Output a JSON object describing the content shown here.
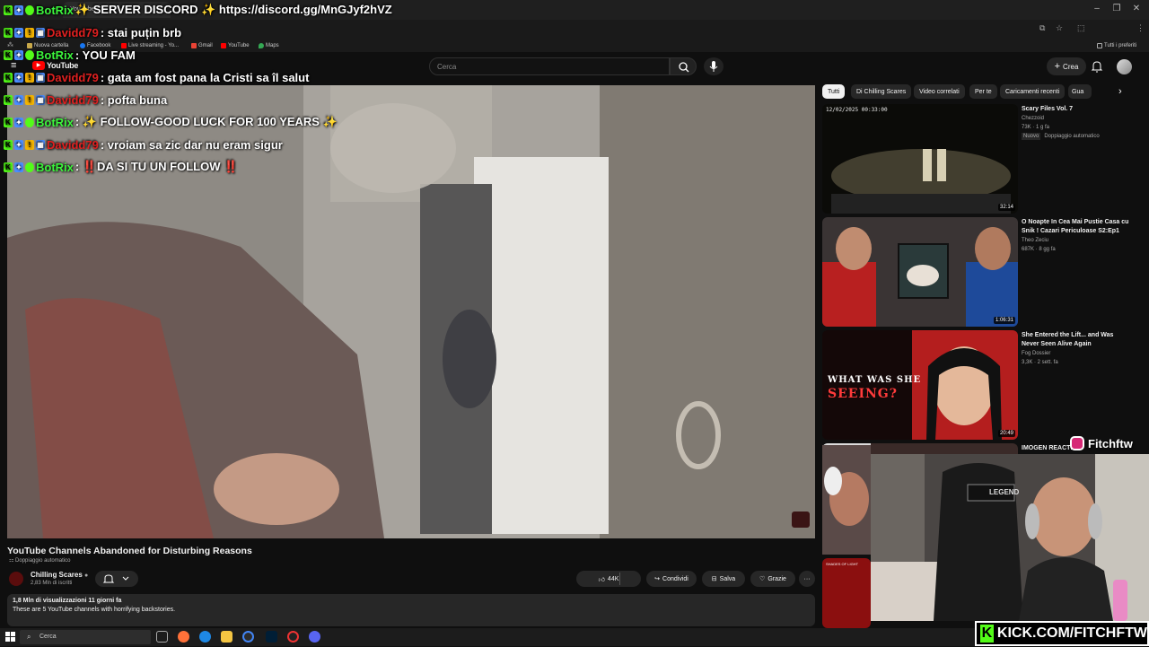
{
  "browser": {
    "tab_title": "YouTube",
    "bookmarks": [
      {
        "label": "Nuova cartella",
        "icon": "folder-icon"
      },
      {
        "label": "Facebook",
        "icon": "facebook-icon"
      },
      {
        "label": "Live streaming - Yo...",
        "icon": "youtube-icon"
      },
      {
        "label": "Gmail",
        "icon": "gmail-icon"
      },
      {
        "label": "YouTube",
        "icon": "youtube-icon"
      },
      {
        "label": "Maps",
        "icon": "maps-icon"
      }
    ],
    "all_bookmarks": "Tutti i preferiti"
  },
  "youtube": {
    "logo": "YouTube",
    "search_placeholder": "Cerca",
    "create_label": "Crea"
  },
  "video": {
    "title": "YouTube Channels Abandoned for Disturbing Reasons",
    "dubbing": "Doppiaggio automatico",
    "channel_name": "Chilling Scares",
    "channel_subs": "2,83 Mln di iscritti",
    "likes": "44K",
    "share_label": "Condividi",
    "save_label": "Salva",
    "thanks_label": "Grazie",
    "views_date": "1,8 Mln di visualizzazioni  11 giorni fa",
    "description": "These are 5 YouTube channels with horrifying backstories."
  },
  "chips": [
    {
      "label": "Tutti",
      "active": true
    },
    {
      "label": "Di Chilling Scares"
    },
    {
      "label": "Video correlati"
    },
    {
      "label": "Per te"
    },
    {
      "label": "Caricamenti recenti"
    },
    {
      "label": "Gua"
    }
  ],
  "recommended": [
    {
      "title": "Scary Files Vol. 7",
      "channel": "Chezzoid",
      "meta": "73K · 1 g fa",
      "badge": "Nuovo",
      "dubbing": "Doppiaggio automatico",
      "duration": "32:14",
      "overlay": "12/02/2025  00:33:00"
    },
    {
      "title": "O Noapte In Cea Mai Pustie Casa cu Snik ! Cazari Periculoase S2:Ep1",
      "channel": "Theo Zeciu",
      "meta": "687K · 8 gg fa",
      "duration": "1:06:31"
    },
    {
      "title": "She Entered the Lift... and Was Never Seen Alive Again",
      "channel": "Fog Dossier",
      "meta": "3,3K · 2 sett. fa",
      "duration": "20:49",
      "overlay_line1": "WHAT WAS SHE",
      "overlay_line2": "SEEING?"
    },
    {
      "title": "IMOGEN REACTI",
      "overlay": "SHADES OF LIGHT"
    }
  ],
  "chat": [
    {
      "user": "BotRix",
      "type": "bot",
      "message": "✨ SERVER DISCORD ✨ https://discord.gg/MnGJyf2hVZ"
    },
    {
      "user": "Davidd79",
      "type": "david",
      "message": ": stai puțin brb"
    },
    {
      "user": "BotRix",
      "type": "bot",
      "message": ":  YOU FAM"
    },
    {
      "user": "Davidd79",
      "type": "david",
      "message": ": gata am fost pana la Cristi sa îl salut"
    },
    {
      "user": "Davidd79",
      "type": "david",
      "message": ": pofta buna"
    },
    {
      "user": "BotRix",
      "type": "bot",
      "message": ": ✨ FOLLOW-GOOD LUCK FOR 100 YEARS ✨"
    },
    {
      "user": "Davidd79",
      "type": "david",
      "message": ": vroiam sa zic dar nu eram sigur"
    },
    {
      "user": "BotRix",
      "type": "bot",
      "message": ": ‼️DA SI TU UN FOLLOW ‼️"
    }
  ],
  "stream": {
    "instagram_handle": "Fitchftw",
    "kick_url": "KICK.COM/FITCHFTW",
    "chair_brand": "LEGEND"
  },
  "taskbar": {
    "search_label": "Cerca"
  },
  "colors": {
    "kick_green": "#53fc18",
    "youtube_red": "#ff0000",
    "bot_name": "#3cf53c",
    "david_name": "#e02020"
  }
}
